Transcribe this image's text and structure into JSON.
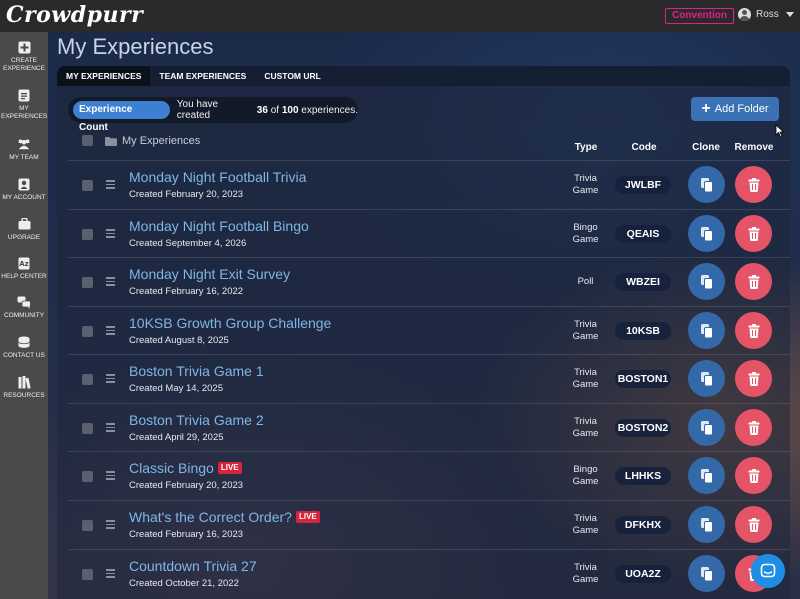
{
  "app": {
    "logo": "Crowdpurr",
    "plan_badge": "Convention",
    "user_name": "Ross"
  },
  "sidebar": {
    "items": [
      {
        "label": "CREATE EXPERIENCE",
        "icon": "plus-square-icon"
      },
      {
        "label": "MY EXPERIENCES",
        "icon": "document-icon"
      },
      {
        "label": "MY TEAM",
        "icon": "team-icon"
      },
      {
        "label": "MY ACCOUNT",
        "icon": "user-card-icon"
      },
      {
        "label": "UPGRADE",
        "icon": "briefcase-icon"
      },
      {
        "label": "HELP CENTER",
        "icon": "help-book-icon"
      },
      {
        "label": "COMMUNITY",
        "icon": "chat-bubbles-icon"
      },
      {
        "label": "CONTACT US",
        "icon": "database-icon"
      },
      {
        "label": "RESOURCES",
        "icon": "books-icon"
      }
    ]
  },
  "main": {
    "title": "My Experiences",
    "tabs": [
      {
        "label": "MY EXPERIENCES",
        "active": true
      },
      {
        "label": "TEAM EXPERIENCES",
        "active": false
      },
      {
        "label": "CUSTOM URL",
        "active": false
      }
    ],
    "experience_count": {
      "badge": "Experience Count",
      "prefix": "You have created",
      "created": "36",
      "middle": "of",
      "limit": "100",
      "suffix": "experiences."
    },
    "add_folder_label": "Add Folder",
    "folder_title": "My Experiences",
    "columns": {
      "type": "Type",
      "code": "Code",
      "clone": "Clone",
      "remove": "Remove"
    }
  },
  "experiences": [
    {
      "name": "Monday Night Football Trivia",
      "created": "Created February 20, 2023",
      "type_line1": "Trivia",
      "type_line2": "Game",
      "code": "JWLBF",
      "live": ""
    },
    {
      "name": "Monday Night Football Bingo",
      "created": "Created September 4, 2026",
      "type_line1": "Bingo",
      "type_line2": "Game",
      "code": "QEAIS",
      "live": ""
    },
    {
      "name": "Monday Night Exit Survey",
      "created": "Created February 16, 2022",
      "type_line1": "Poll",
      "type_line2": "",
      "code": "WBZEI",
      "live": ""
    },
    {
      "name": "10KSB Growth Group Challenge",
      "created": "Created August 8, 2025",
      "type_line1": "Trivia",
      "type_line2": "Game",
      "code": "10KSB",
      "live": ""
    },
    {
      "name": "Boston Trivia Game 1",
      "created": "Created May 14, 2025",
      "type_line1": "Trivia",
      "type_line2": "Game",
      "code": "BOSTON1",
      "live": ""
    },
    {
      "name": "Boston Trivia Game 2",
      "created": "Created April 29, 2025",
      "type_line1": "Trivia",
      "type_line2": "Game",
      "code": "BOSTON2",
      "live": ""
    },
    {
      "name": "Classic Bingo",
      "created": "Created February 20, 2023",
      "type_line1": "Bingo",
      "type_line2": "Game",
      "code": "LHHKS",
      "live": "LIVE"
    },
    {
      "name": "What's the Correct Order?",
      "created": "Created February 16, 2023",
      "type_line1": "Trivia",
      "type_line2": "Game",
      "code": "DFKHX",
      "live": "LIVE"
    },
    {
      "name": "Countdown Trivia 27",
      "created": "Created October 21, 2022",
      "type_line1": "Trivia",
      "type_line2": "Game",
      "code": "UOA2Z",
      "live": ""
    }
  ],
  "colors": {
    "accent_blue": "#3469a9",
    "remove_red": "#e55466",
    "link_blue": "#7fb6e8",
    "live_red": "#d9243c",
    "plan_pink": "#e0218a"
  }
}
